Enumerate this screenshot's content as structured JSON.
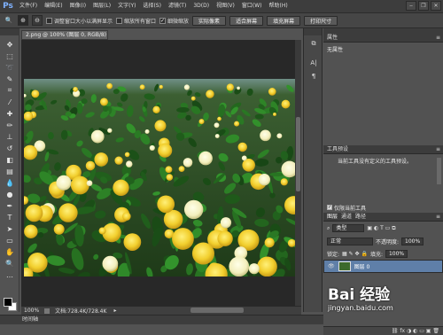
{
  "app": {
    "logo": "Ps"
  },
  "menubar": {
    "items": [
      "文件(F)",
      "编辑(E)",
      "图像(I)",
      "图层(L)",
      "文字(Y)",
      "选择(S)",
      "滤镜(T)",
      "3D(D)",
      "视图(V)",
      "窗口(W)",
      "帮助(H)"
    ]
  },
  "window_controls": {
    "minimize": "‒",
    "restore": "❐",
    "close": "✕"
  },
  "options_bar": {
    "tool_icon": "🔍",
    "checkbox1": {
      "label": "调整窗口大小以满屏显示",
      "checked": false
    },
    "checkbox2": {
      "label": "缩放所有窗口",
      "checked": false
    },
    "checkbox3": {
      "label": "细微缩放",
      "checked": true
    },
    "buttons": [
      "实际像素",
      "适合屏幕",
      "填充屏幕",
      "打印尺寸"
    ]
  },
  "document": {
    "tab_title": "2.png @ 100% (图层 0, RGB/8)"
  },
  "status": {
    "zoom": "100%",
    "doc_info": "文档:728.4K/728.4K"
  },
  "timeline": {
    "label": "时间轴"
  },
  "properties_panel": {
    "title": "属性",
    "content": "无属性"
  },
  "tool_presets_panel": {
    "title": "工具预设",
    "content": "当前工具没有定义的工具预设。",
    "checkbox_label": "仅限当前工具"
  },
  "layers_panel": {
    "tabs": [
      "图层",
      "通道",
      "路径"
    ],
    "filter": "类型",
    "blend_mode": "正常",
    "opacity_label": "不透明度:",
    "opacity_value": "100%",
    "lock_label": "锁定:",
    "fill_label": "填充:",
    "fill_value": "100%",
    "layer_name": "图层 0"
  },
  "watermark": {
    "brand": "Bai 经验",
    "url": "jingyan.baidu.com"
  },
  "colors": {
    "accent": "#5f7fa8",
    "background": "#535353",
    "menubar": "#3d3d3d",
    "flower_yellow": "#f3d23a",
    "flower_white": "#f5f2c8"
  }
}
